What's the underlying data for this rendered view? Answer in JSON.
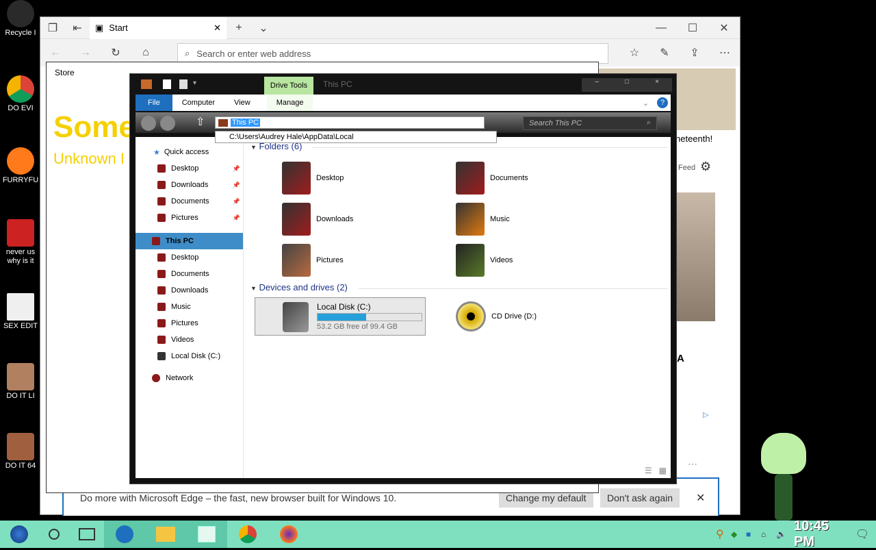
{
  "desktop": {
    "icons": [
      {
        "label": "Recycle I",
        "color": "#2a2a2a"
      },
      {
        "label": "DO EVI",
        "color": "#1f73d8"
      },
      {
        "label": "FURRYFU",
        "color": "#ff7a1a"
      },
      {
        "label": "never us why is it",
        "color": "#c22"
      },
      {
        "label": "SEX EDIT",
        "color": "#efefef"
      },
      {
        "label": "DO IT LI",
        "color": "#b08060"
      },
      {
        "label": "DO IT 64",
        "color": "#a06040"
      }
    ]
  },
  "edge": {
    "tab_label": "Start",
    "address_placeholder": "Search or enter web address",
    "side_text_1": "neteenth!",
    "side_text_2": "Feed",
    "side_text_3": "A",
    "bottom_banner": "Do more with Microsoft Edge – the fast, new browser built for Windows 10.",
    "change_default": "Change my default",
    "dont_ask": "Don't ask again"
  },
  "store": {
    "title": "Store",
    "headline": "Some",
    "subline": "Unknown I"
  },
  "explorer": {
    "drive_tools": "Drive Tools",
    "window_title": "This PC",
    "menu": {
      "file": "File",
      "computer": "Computer",
      "view": "View",
      "manage": "Manage"
    },
    "address_value": "This PC",
    "address_suggestion": "C:\\Users\\Audrey Hale\\AppData\\Local",
    "search_placeholder": "Search This PC",
    "nav": {
      "quick_access": "Quick access",
      "qa_items": [
        "Desktop",
        "Downloads",
        "Documents",
        "Pictures"
      ],
      "this_pc": "This PC",
      "pc_items": [
        "Desktop",
        "Documents",
        "Downloads",
        "Music",
        "Pictures",
        "Videos",
        "Local Disk (C:)"
      ],
      "network": "Network"
    },
    "folders_header": "Folders (6)",
    "folders": [
      "Desktop",
      "Documents",
      "Downloads",
      "Music",
      "Pictures",
      "Videos"
    ],
    "devices_header": "Devices and drives (2)",
    "drive_c": {
      "name": "Local Disk (C:)",
      "free": "53.2 GB free of 99.4 GB",
      "used_fraction": 0.465
    },
    "drive_d": {
      "name": "CD Drive (D:)"
    }
  },
  "taskbar": {
    "clock": "10:45 PM"
  }
}
